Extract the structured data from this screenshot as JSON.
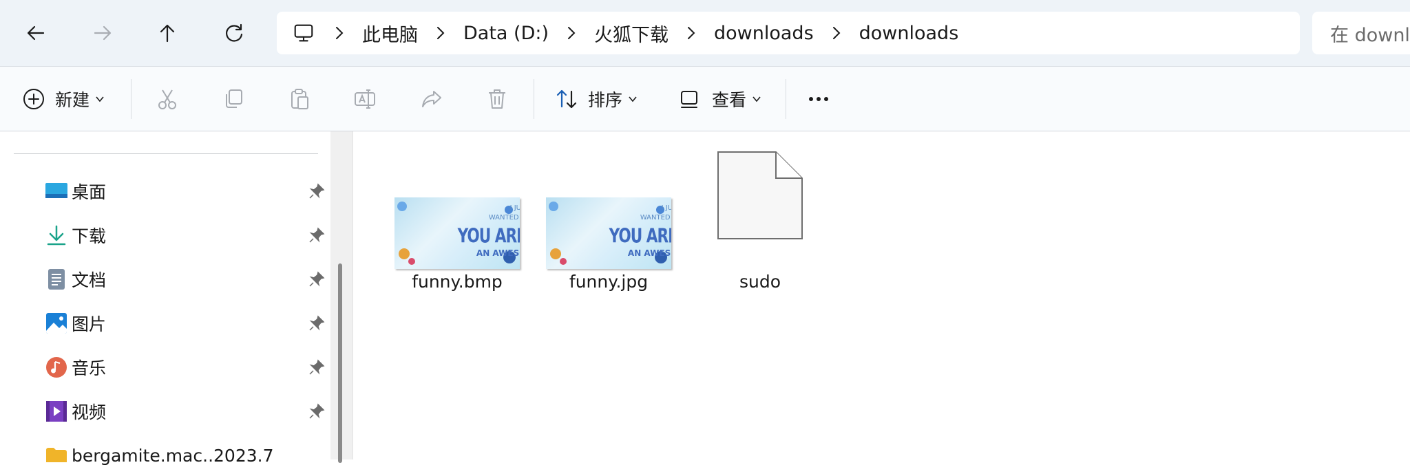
{
  "nav": {
    "back": "back-arrow-icon",
    "forward": "forward-arrow-icon",
    "up": "up-arrow-icon",
    "refresh": "refresh-icon"
  },
  "breadcrumb": [
    "此电脑",
    "Data (D:)",
    "火狐下载",
    "downloads",
    "downloads"
  ],
  "search": {
    "placeholder": "在 downloads 中搜索"
  },
  "commands": {
    "new_label": "新建",
    "sort_label": "排序",
    "view_label": "查看",
    "more_label": "..."
  },
  "sidebar": {
    "items": [
      {
        "label": "桌面",
        "icon": "desktop-icon"
      },
      {
        "label": "下载",
        "icon": "download-icon"
      },
      {
        "label": "文档",
        "icon": "documents-icon"
      },
      {
        "label": "图片",
        "icon": "pictures-icon"
      },
      {
        "label": "音乐",
        "icon": "music-icon"
      },
      {
        "label": "视频",
        "icon": "videos-icon"
      },
      {
        "label": "bergamite.mac..2023.7",
        "icon": "folder-icon"
      }
    ]
  },
  "files": [
    {
      "name": "funny.bmp",
      "thumb": [
        "I JUST",
        "WANTED TO SAY...",
        "YOU ARE DOING",
        "AN AWESOME JOB!"
      ]
    },
    {
      "name": "funny.jpg",
      "thumb": [
        "I JUST",
        "WANTED TO SAY...",
        "YOU ARE DOING",
        "AN AWESOME JOB!"
      ]
    },
    {
      "name": "sudo"
    }
  ],
  "colors": {
    "topbar_bg": "#eef3f8",
    "accent": "#0067c0"
  }
}
